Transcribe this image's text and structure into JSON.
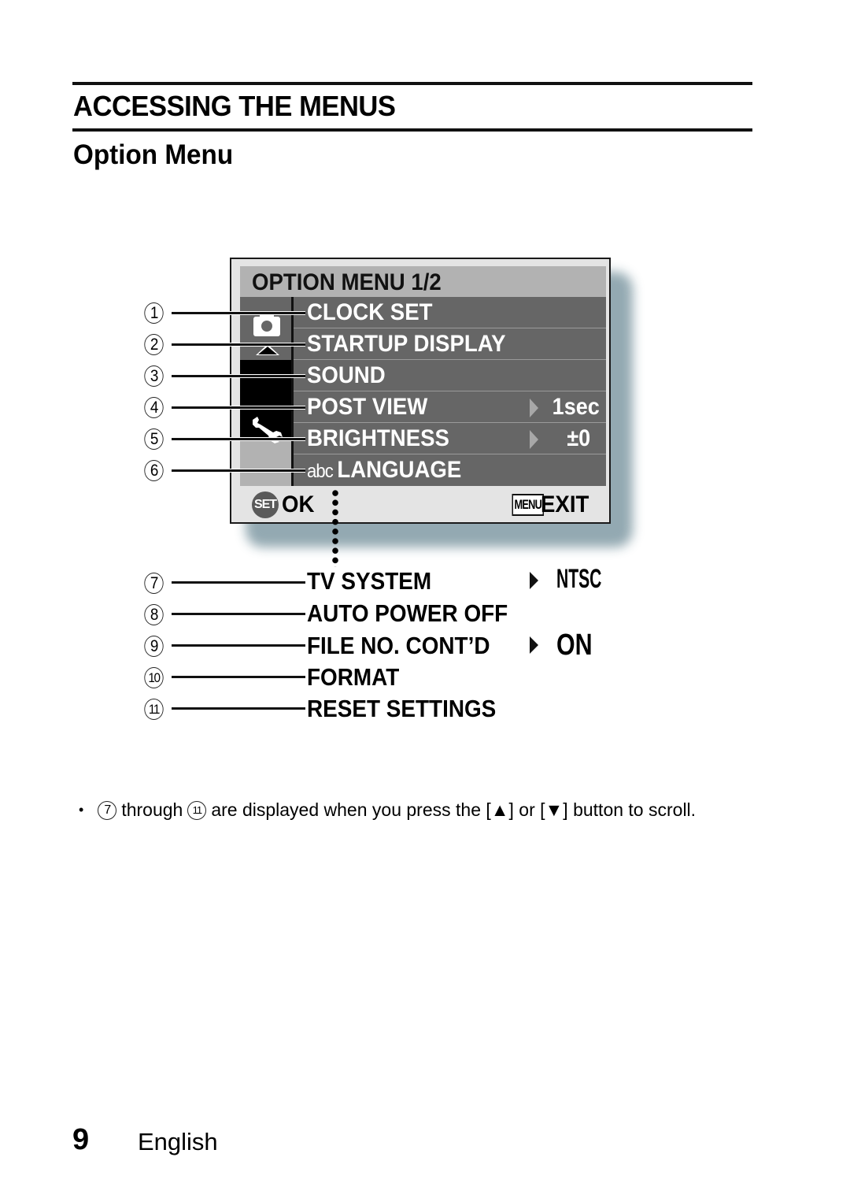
{
  "section_title": "ACCESSING THE MENUS",
  "subsection_title": "Option Menu",
  "menu_screen": {
    "title": "OPTION MENU 1/2",
    "tabs": [
      {
        "icon": "camera-icon",
        "selected": false
      },
      {
        "icon": "wrench-icon",
        "selected": true
      }
    ],
    "items": [
      {
        "num": "1",
        "label": "CLOCK SET",
        "value": ""
      },
      {
        "num": "2",
        "label": "STARTUP DISPLAY",
        "value": ""
      },
      {
        "num": "3",
        "label": "SOUND",
        "value": ""
      },
      {
        "num": "4",
        "label": "POST VIEW",
        "value": "1sec"
      },
      {
        "num": "5",
        "label": "BRIGHTNESS",
        "value": "±0"
      },
      {
        "num": "6",
        "label": "LANGUAGE",
        "prefix_icon": "abc",
        "value": ""
      }
    ],
    "footer": {
      "ok_button_icon": "SET",
      "ok_label": "OK",
      "exit_button_icon": "MENU",
      "exit_label": "EXIT"
    }
  },
  "scroll_items": [
    {
      "num": "7",
      "label": "TV SYSTEM",
      "value": "NTSC"
    },
    {
      "num": "8",
      "label": "AUTO POWER OFF",
      "value": ""
    },
    {
      "num": "9",
      "label": "FILE NO. CONT’D",
      "value": "ON"
    },
    {
      "num": "10",
      "label": "FORMAT",
      "value": ""
    },
    {
      "num": "11",
      "label": "RESET SETTINGS",
      "value": ""
    }
  ],
  "note": {
    "bullet": "•",
    "from_num": "7",
    "through": "through",
    "to_num": "11",
    "text": "are displayed when you press the [▲] or [▼] button to scroll."
  },
  "footer": {
    "page_number": "9",
    "language": "English"
  }
}
